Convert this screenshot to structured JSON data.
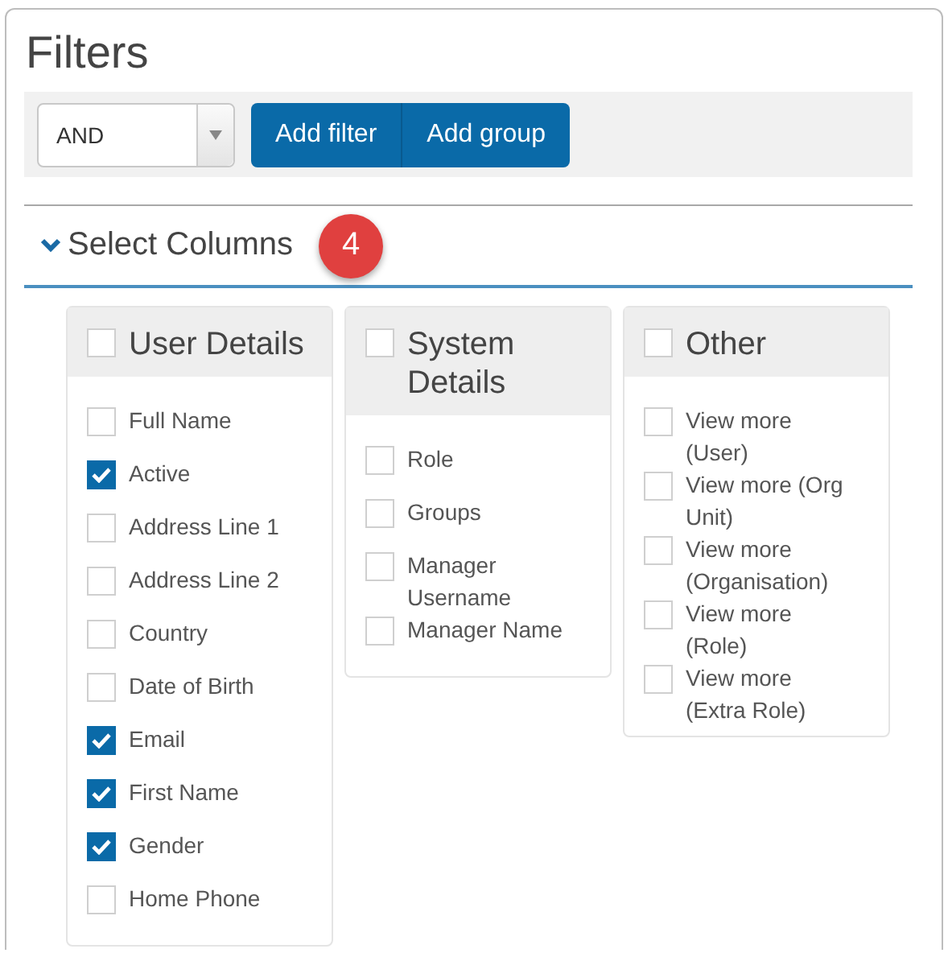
{
  "title": "Filters",
  "toolbar": {
    "operator": "AND",
    "buttons": [
      "Add filter",
      "Add group"
    ]
  },
  "section": {
    "title": "Select Columns",
    "expanded": true,
    "badge": "4"
  },
  "columns": [
    {
      "title": "User Details",
      "checked": false,
      "items": [
        {
          "label": "Full Name",
          "checked": false
        },
        {
          "label": "Active",
          "checked": true
        },
        {
          "label": "Address Line 1",
          "checked": false
        },
        {
          "label": "Address Line 2",
          "checked": false
        },
        {
          "label": "Country",
          "checked": false
        },
        {
          "label": "Date of Birth",
          "checked": false
        },
        {
          "label": "Email",
          "checked": true
        },
        {
          "label": "First Name",
          "checked": true
        },
        {
          "label": "Gender",
          "checked": true
        },
        {
          "label": "Home Phone",
          "checked": false
        }
      ]
    },
    {
      "title": "System Details",
      "checked": false,
      "items": [
        {
          "label": "Role",
          "checked": false
        },
        {
          "label": "Groups",
          "checked": false
        },
        {
          "label": "Manager Username",
          "checked": false
        },
        {
          "label": "Manager Name",
          "checked": false
        }
      ]
    },
    {
      "title": "Other",
      "checked": false,
      "items": [
        {
          "label": "View more (User)",
          "checked": false
        },
        {
          "label": "View more (Org Unit)",
          "checked": false
        },
        {
          "label": "View more (Organisation)",
          "checked": false
        },
        {
          "label": "View more (Role)",
          "checked": false
        },
        {
          "label": "View more (Extra Role)",
          "checked": false
        }
      ]
    }
  ]
}
